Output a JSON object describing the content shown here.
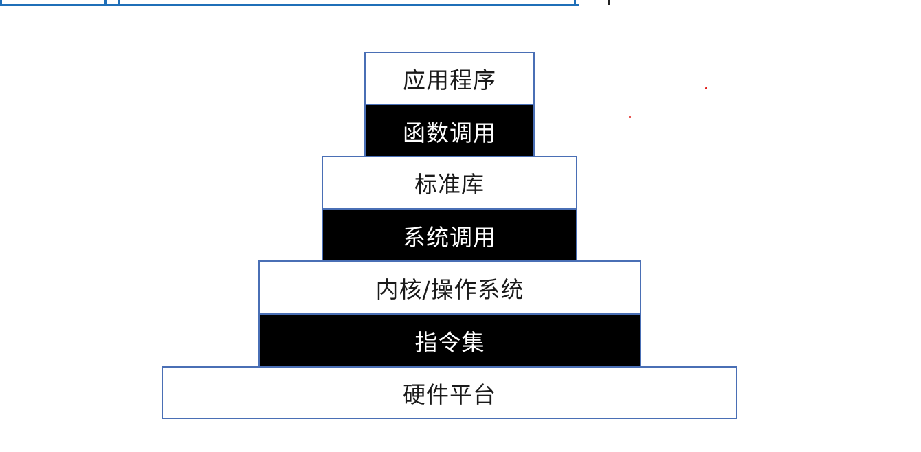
{
  "stack": {
    "app": "应用程序",
    "func_call": "函数调用",
    "stdlib": "标准库",
    "syscall": "系统调用",
    "kernel": "内核/操作系统",
    "isa": "指令集",
    "hardware": "硬件平台"
  },
  "colors": {
    "border": "#4a6fb5",
    "dark_fill": "#000000",
    "light_fill": "#ffffff",
    "accent_line": "#1f6fb8",
    "dot": "#e0201c"
  }
}
